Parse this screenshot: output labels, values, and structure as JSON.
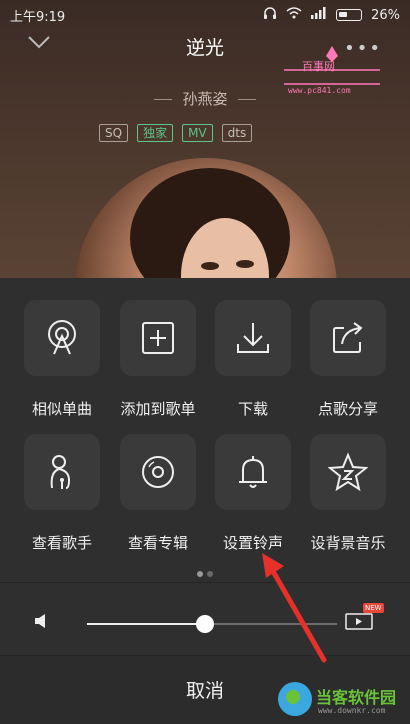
{
  "status_bar": {
    "time": "上午9:19",
    "battery": "26%"
  },
  "player": {
    "song_title": "逆光",
    "artist": "孙燕姿",
    "tags": [
      "SQ",
      "独家",
      "MV",
      "dts"
    ]
  },
  "watermark_top": {
    "brand": "百事网",
    "url": "www.pc841.com"
  },
  "actions": [
    {
      "label": "相似单曲",
      "icon": "similar-icon"
    },
    {
      "label": "添加到歌单",
      "icon": "add-square-icon"
    },
    {
      "label": "下载",
      "icon": "download-icon"
    },
    {
      "label": "点歌分享",
      "icon": "share-icon"
    },
    {
      "label": "查看歌手",
      "icon": "singer-icon"
    },
    {
      "label": "查看专辑",
      "icon": "album-disc-icon"
    },
    {
      "label": "设置铃声",
      "icon": "bell-icon"
    },
    {
      "label": "设背景音乐",
      "icon": "star-badge-icon"
    }
  ],
  "volume": {
    "level": 0.47
  },
  "video": {
    "badge": "NEW"
  },
  "cancel_label": "取消",
  "watermark_bottom": {
    "title": "当客软件园",
    "url": "www.downkr.com"
  }
}
